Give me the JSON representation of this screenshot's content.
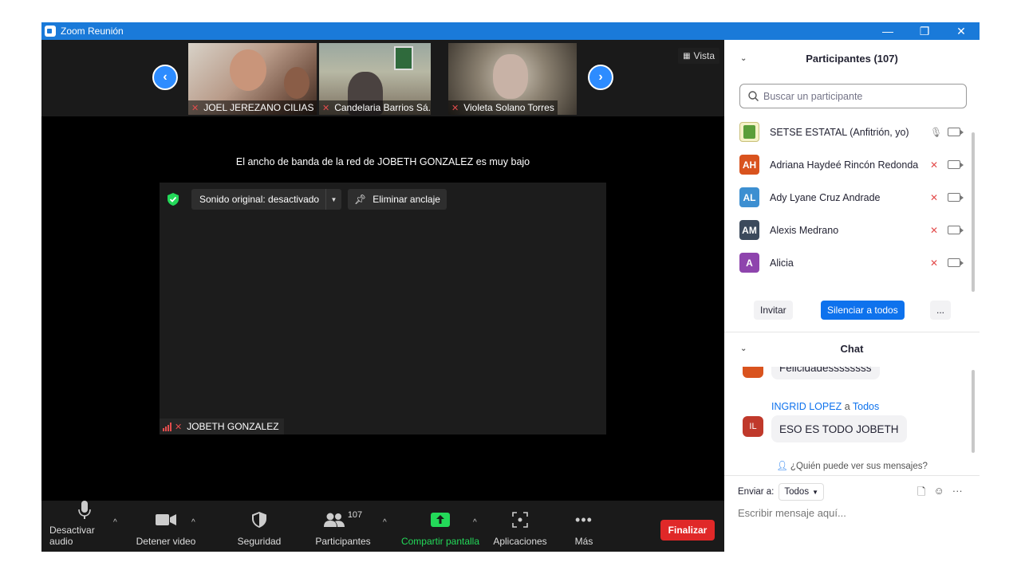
{
  "window": {
    "title": "Zoom Reunión",
    "minimize": "—",
    "restore": "❐",
    "close": "✕"
  },
  "strip": {
    "view_label": "Vista",
    "thumbs": [
      {
        "name": "JOEL JEREZANO CILIAS"
      },
      {
        "name": "Candelaria Barrios Sá..."
      },
      {
        "name": "Violeta Solano Torres"
      }
    ]
  },
  "stage": {
    "bandwidth_notice": "El ancho de banda de la red de JOBETH GONZALEZ es muy bajo",
    "audio_label": "Sonido original: desactivado",
    "unpin_label": "Eliminar anclaje",
    "main_name": "JOBETH GONZALEZ"
  },
  "toolbar": {
    "audio": "Desactivar audio",
    "video": "Detener video",
    "security": "Seguridad",
    "participants": "Participantes",
    "participants_count": "107",
    "share": "Compartir pantalla",
    "apps": "Aplicaciones",
    "more": "Más",
    "end": "Finalizar"
  },
  "participants": {
    "header": "Participantes (107)",
    "search_placeholder": "Buscar un participante",
    "list": [
      {
        "name": "SETSE ESTATAL (Anfitrión, yo)",
        "initials": "",
        "color": "#e8e8a0"
      },
      {
        "name": "Adriana Haydeé Rincón Redonda",
        "initials": "AH",
        "color": "#d9531e"
      },
      {
        "name": "Ady Lyane Cruz Andrade",
        "initials": "AL",
        "color": "#3d8fd1"
      },
      {
        "name": "Alexis Medrano",
        "initials": "AM",
        "color": "#3c4a5c"
      },
      {
        "name": "Alicia",
        "initials": "A",
        "color": "#8e44ad"
      }
    ],
    "invite": "Invitar",
    "mute_all": "Silenciar a todos",
    "more": "..."
  },
  "chat": {
    "header": "Chat",
    "prev_message": "Felicidadessssssss",
    "sender": "INGRID LOPEZ",
    "to_word": "a",
    "recipient": "Todos",
    "sender_initials": "IL",
    "message": "ESO ES TODO JOBETH",
    "who_can_see": "¿Quién puede ver sus mensajes?",
    "send_to_label": "Enviar a:",
    "send_to_value": "Todos",
    "input_placeholder": "Escribir mensaje aquí..."
  },
  "colors": {
    "accent": "#0e72ed",
    "titlebar": "#1a7ad9",
    "end": "#e02828",
    "share": "#23d959",
    "muted": "#e34d4d"
  }
}
